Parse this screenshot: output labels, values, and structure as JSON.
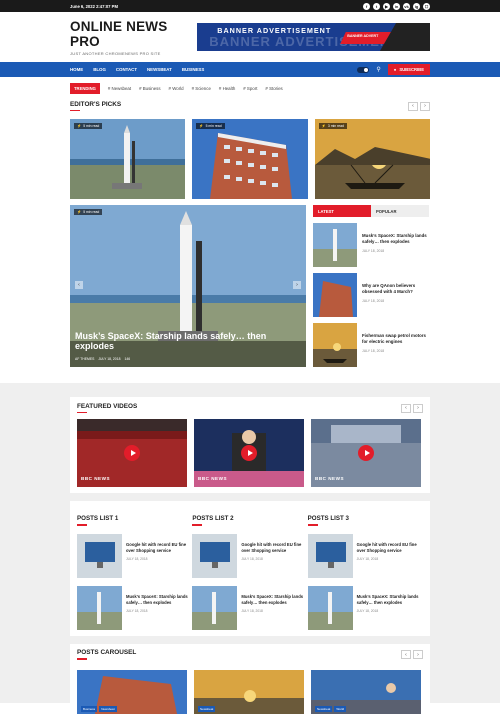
{
  "topbar": {
    "date": "June 6, 2022 2:47:07 PM",
    "socials": [
      "f",
      "t",
      "▶",
      "in",
      "vk",
      "ig",
      "☐"
    ]
  },
  "header": {
    "title": "ONLINE NEWS PRO",
    "tagline": "JUST ANOTHER CHROMENEWS PRO SITE",
    "banner_text": "BANNER ADVERTISEMENT",
    "banner_small": "BANNER ADVERT"
  },
  "nav": {
    "items": [
      "HOME",
      "BLOG",
      "CONTACT",
      "NEWSBEAT",
      "BUSINESS"
    ],
    "subscribe": "SUBSCRIBE"
  },
  "trending": {
    "label": "TRENDING",
    "tags": [
      "# Newsbeat",
      "# Business",
      "# World",
      "# Science",
      "# Health",
      "# Sport",
      "# Stories"
    ]
  },
  "editors_picks": {
    "title": "EDITOR'S PICKS",
    "cards": [
      {
        "badge": "5 min read"
      },
      {
        "badge": "5 min read"
      },
      {
        "badge": "3 min read"
      }
    ],
    "featured": {
      "badge": "5 min read",
      "title": "Musk’s SpaceX: Starship lands safely… then explodes",
      "author": "AF THEMES",
      "date": "JULY 18, 2018",
      "views": "146"
    }
  },
  "sidebar": {
    "tab_latest": "LATEST",
    "tab_popular": "POPULAR",
    "items": [
      {
        "title": "Musk’s SpaceX: Starship lands safely… then explodes",
        "date": "JULY 18, 2018"
      },
      {
        "title": "Why are QAnon believers obsessed with 4 March?",
        "date": "JULY 18, 2018"
      },
      {
        "title": "Fisherman swap petrol motors for electric engines",
        "date": "JULY 18, 2018"
      }
    ]
  },
  "featured_videos": {
    "title": "FEATURED VIDEOS",
    "items": [
      {
        "logo": "BBC NEWS"
      },
      {
        "logo": "BBC NEWS"
      },
      {
        "logo": "BBC NEWS"
      }
    ]
  },
  "posts_lists": [
    {
      "title": "POSTS LIST 1",
      "items": [
        {
          "title": "Google hit with record EU fine over Shopping service",
          "date": "JULY 18, 2018"
        },
        {
          "title": "Musk’s SpaceX: Starship lands safely… then explodes",
          "date": "JULY 18, 2018"
        }
      ]
    },
    {
      "title": "POSTS LIST 2",
      "items": [
        {
          "title": "Google hit with record EU fine over Shopping service",
          "date": "JULY 18, 2018"
        },
        {
          "title": "Musk’s SpaceX: Starship lands safely… then explodes",
          "date": "JULY 18, 2018"
        }
      ]
    },
    {
      "title": "POSTS LIST 3",
      "items": [
        {
          "title": "Google hit with record EU fine over Shopping service",
          "date": "JULY 18, 2018"
        },
        {
          "title": "Musk’s SpaceX: Starship lands safely… then explodes",
          "date": "JULY 18, 2018"
        }
      ]
    }
  ],
  "carousel": {
    "title": "POSTS CAROUSEL",
    "tags": [
      [
        "Business",
        "Newsbeat"
      ],
      [
        "Newsbeat"
      ],
      [
        "Newsbeat",
        "World"
      ]
    ]
  }
}
